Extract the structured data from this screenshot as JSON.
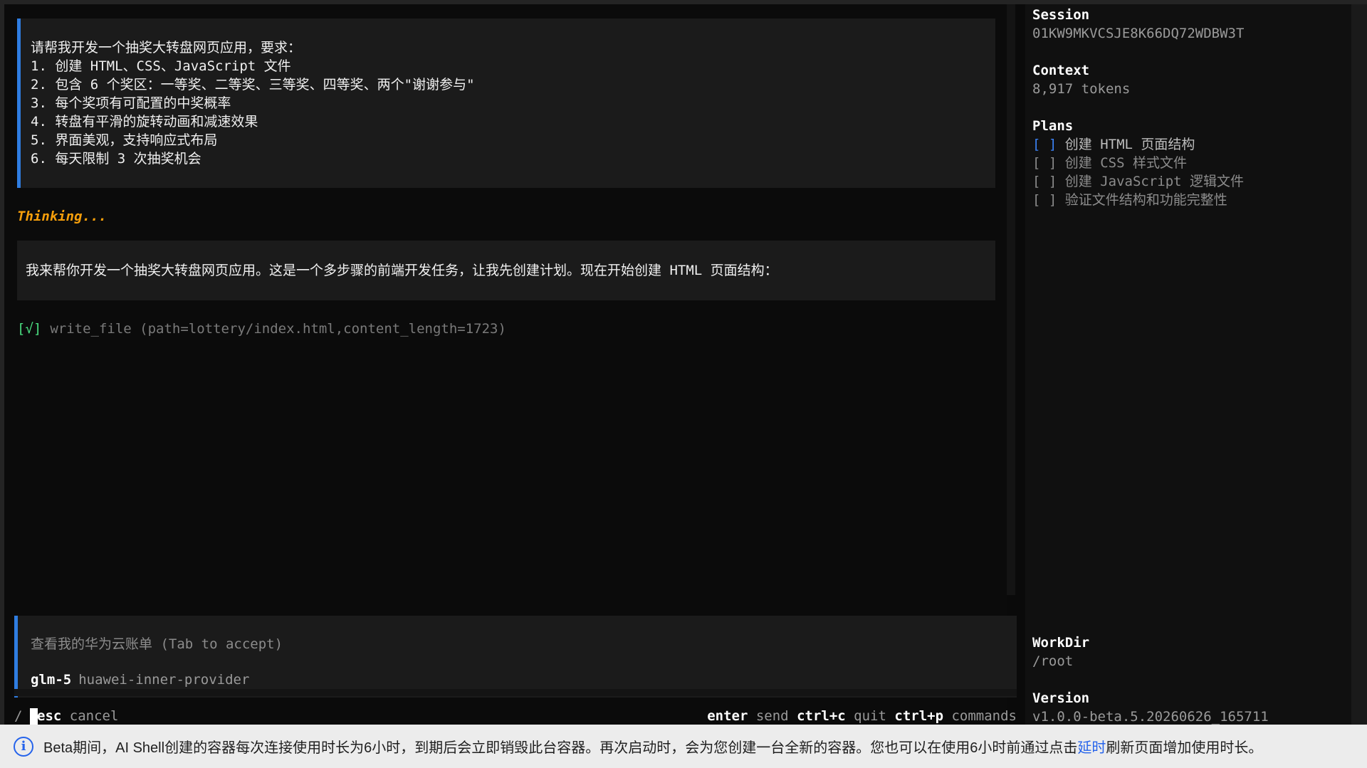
{
  "chat": {
    "user_message": [
      "请帮我开发一个抽奖大转盘网页应用，要求：",
      "1. 创建 HTML、CSS、JavaScript 文件",
      "2. 包含 6 个奖区：一等奖、二等奖、三等奖、四等奖、两个\"谢谢参与\"",
      "3. 每个奖项有可配置的中奖概率",
      "4. 转盘有平滑的旋转动画和减速效果",
      "5. 界面美观，支持响应式布局",
      "6. 每天限制 3 次抽奖机会"
    ],
    "thinking": "Thinking...",
    "assistant_message": "我来帮你开发一个抽奖大转盘网页应用。这是一个多步骤的前端开发任务，让我先创建计划。现在开始创建 HTML 页面结构：",
    "tool_call": {
      "status": "[√]",
      "name": "write_file",
      "args": "(path=lottery/index.html,content_length=1723)"
    }
  },
  "input": {
    "placeholder": "查看我的华为云账单 (Tab to accept)",
    "model": "glm-5",
    "provider": "huawei-inner-provider"
  },
  "hints": {
    "slash": "/",
    "esc_key": "esc",
    "esc_desc": "cancel",
    "enter_key": "enter",
    "enter_desc": "send",
    "quit_key": "ctrl+c",
    "quit_desc": "quit",
    "cmd_key": "ctrl+p",
    "cmd_desc": "commands"
  },
  "sidebar": {
    "session_title": "Session",
    "session_id": "01KW9MKVCSJE8K66DQ72WDBW3T",
    "context_title": "Context",
    "context_value": "8,917 tokens",
    "plans_title": "Plans",
    "plans": [
      {
        "box": "[ ]",
        "label": "创建 HTML 页面结构",
        "active": true
      },
      {
        "box": "[ ]",
        "label": "创建 CSS 样式文件",
        "active": false
      },
      {
        "box": "[ ]",
        "label": "创建 JavaScript 逻辑文件",
        "active": false
      },
      {
        "box": "[ ]",
        "label": "验证文件结构和功能完整性",
        "active": false
      }
    ],
    "workdir_title": "WorkDir",
    "workdir_value": "/root",
    "version_title": "Version",
    "version_value": "v1.0.0-beta.5.20260626_165711"
  },
  "banner": {
    "text_before": "Beta期间，AI Shell创建的容器每次连接使用时长为6小时，到期后会立即销毁此台容器。再次启动时，会为您创建一台全新的容器。您也可以在使用6小时前通过点击",
    "link": "延时",
    "text_after": "刷新页面增加使用时长。",
    "icon": "info-icon"
  },
  "colors": {
    "accent": "#2f7de1",
    "thinking": "#f59e0b",
    "success": "#4ade80",
    "link": "#2563eb"
  }
}
